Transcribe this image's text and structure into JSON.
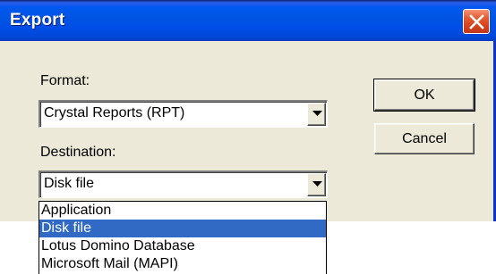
{
  "window": {
    "title": "Export"
  },
  "format": {
    "label": "Format:",
    "value": "Crystal Reports (RPT)"
  },
  "destination": {
    "label": "Destination:",
    "value": "Disk file",
    "options": [
      {
        "label": "Application"
      },
      {
        "label": "Disk file"
      },
      {
        "label": "Lotus Domino Database"
      },
      {
        "label": "Microsoft Mail (MAPI)"
      }
    ],
    "selected_option": "Disk file"
  },
  "buttons": {
    "ok_label": "OK",
    "cancel_label": "Cancel"
  },
  "icons": {
    "close": "close-icon",
    "dropdown_arrow": "chevron-down-icon"
  },
  "colors": {
    "titlebar": "#0054e3",
    "dialog_bg": "#ece9d8",
    "close_button": "#d6411b",
    "selection": "#316ac5"
  }
}
